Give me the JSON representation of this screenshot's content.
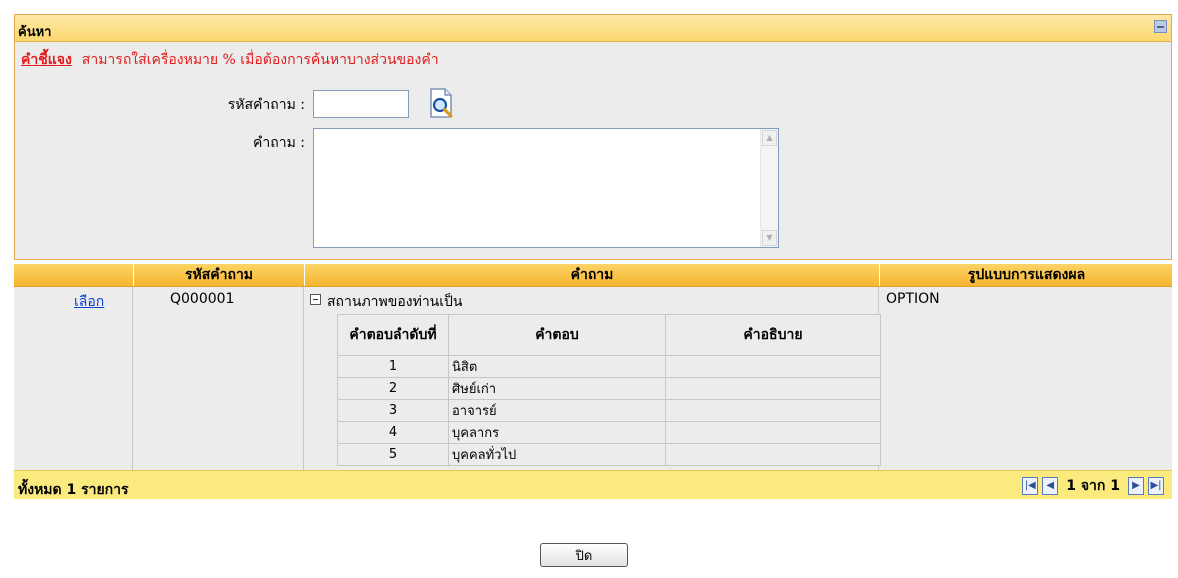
{
  "search": {
    "title": "ค้นหา",
    "hint_label": "คำชี้แจง",
    "hint_text": "สามารถใส่เครื่องหมาย % เมื่อต้องการค้นหาบางส่วนของคำ",
    "question_id_label": "รหัสคำถาม :",
    "question_id_value": "",
    "question_label": "คำถาม :",
    "question_value": ""
  },
  "grid": {
    "columns": [
      "",
      "รหัสคำถาม",
      "คำถาม",
      "รูปแบบการแสดงผล"
    ],
    "rows": [
      {
        "select_label": "เลือก",
        "question_id": "Q000001",
        "question": "สถานภาพของท่านเป็น",
        "display_type": "OPTION",
        "answer_columns": [
          "คำตอบลำดับที่",
          "คำตอบ",
          "คำอธิบาย"
        ],
        "answers": [
          {
            "no": "1",
            "answer": "นิสิต",
            "desc": ""
          },
          {
            "no": "2",
            "answer": "ศิษย์เก่า",
            "desc": ""
          },
          {
            "no": "3",
            "answer": "อาจารย์",
            "desc": ""
          },
          {
            "no": "4",
            "answer": "บุคลากร",
            "desc": ""
          },
          {
            "no": "5",
            "answer": "บุคคลทั่วไป",
            "desc": ""
          }
        ]
      }
    ],
    "total_text": "ทั้งหมด 1 รายการ",
    "pager_text": "1 จาก 1"
  },
  "close_label": "ปิด",
  "icons": [
    "collapse-icon",
    "lookup-magnifier-icon",
    "first-page-icon",
    "prev-page-icon",
    "next-page-icon",
    "last-page-icon"
  ]
}
